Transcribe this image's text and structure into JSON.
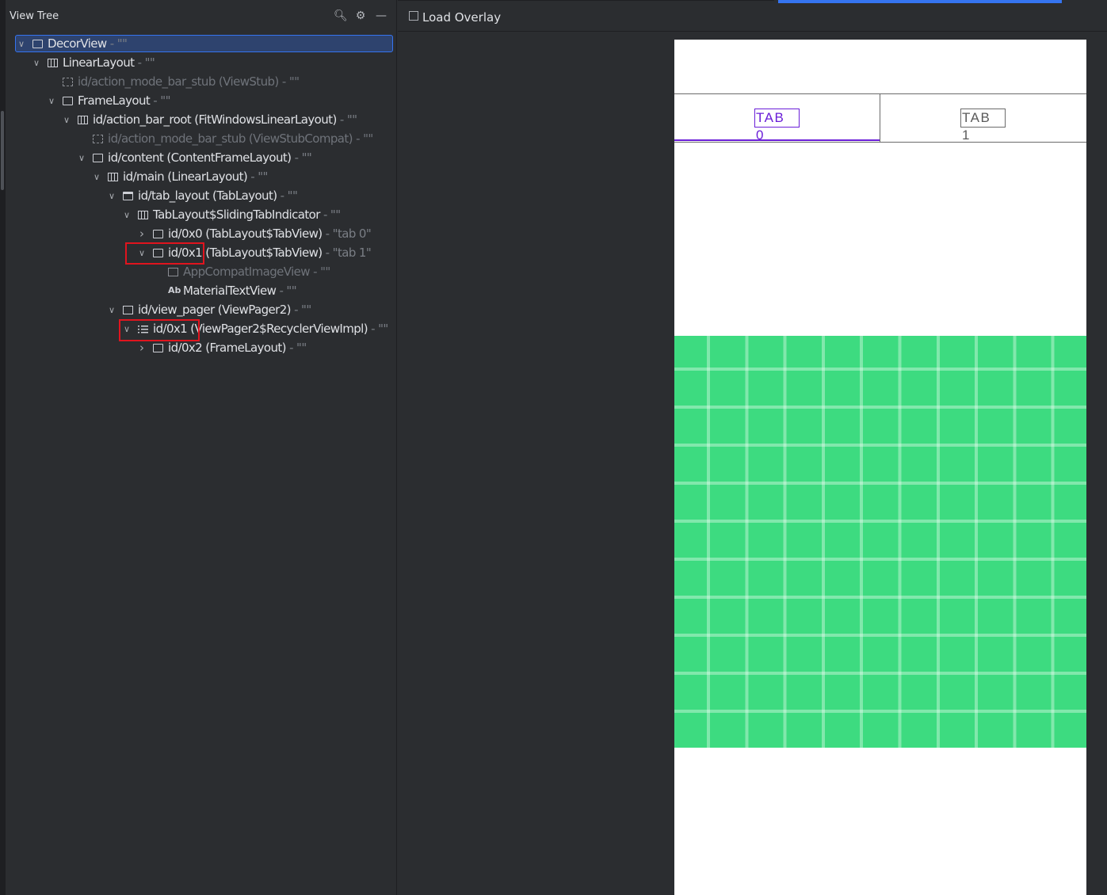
{
  "tree_panel": {
    "title": "View Tree",
    "icons": [
      "search-icon",
      "gear-icon",
      "minimize-icon"
    ]
  },
  "tree": [
    {
      "label": "DecorView",
      "suffix": " - \"\"",
      "depth": 0,
      "chevron": "down",
      "icon": "rect",
      "selected": true,
      "dim": false
    },
    {
      "label": "LinearLayout",
      "suffix": " - \"\"",
      "depth": 1,
      "chevron": "down",
      "icon": "linear",
      "dim": false
    },
    {
      "label": "id/action_mode_bar_stub (ViewStub)",
      "suffix": " - \"\"",
      "depth": 2,
      "chevron": "",
      "icon": "dash",
      "dim": true
    },
    {
      "label": "FrameLayout",
      "suffix": " - \"\"",
      "depth": 2,
      "chevron": "down",
      "icon": "rect",
      "dim": false
    },
    {
      "label": "id/action_bar_root (FitWindowsLinearLayout)",
      "suffix": " - \"\"",
      "depth": 3,
      "chevron": "down",
      "icon": "linear",
      "dim": false
    },
    {
      "label": "id/action_mode_bar_stub (ViewStubCompat)",
      "suffix": " - \"\"",
      "depth": 4,
      "chevron": "",
      "icon": "dash",
      "dim": true
    },
    {
      "label": "id/content (ContentFrameLayout)",
      "suffix": " - \"\"",
      "depth": 4,
      "chevron": "down",
      "icon": "rect",
      "dim": false
    },
    {
      "label": "id/main (LinearLayout)",
      "suffix": " - \"\"",
      "depth": 5,
      "chevron": "down",
      "icon": "linear",
      "dim": false
    },
    {
      "label": "id/tab_layout (TabLayout)",
      "suffix": " - \"\"",
      "depth": 6,
      "chevron": "down",
      "icon": "folder",
      "dim": false
    },
    {
      "label": "TabLayout$SlidingTabIndicator",
      "suffix": " - \"\"",
      "depth": 7,
      "chevron": "down",
      "icon": "linear",
      "dim": false
    },
    {
      "label": "id/0x0 (TabLayout$TabView)",
      "suffix": " - \"tab 0\"",
      "depth": 8,
      "chevron": "right",
      "icon": "rect",
      "dim": false
    },
    {
      "label": "id/0x1 (TabLayout$TabView)",
      "suffix": " - \"tab 1\"",
      "depth": 8,
      "chevron": "down",
      "icon": "rect",
      "dim": false
    },
    {
      "label": "AppCompatImageView",
      "suffix": " - \"\"",
      "depth": 9,
      "chevron": "",
      "icon": "image",
      "dim": true
    },
    {
      "label": "MaterialTextView",
      "suffix": " - \"\"",
      "depth": 9,
      "chevron": "",
      "icon": "ab",
      "dim": false
    },
    {
      "label": "id/view_pager (ViewPager2)",
      "suffix": " - \"\"",
      "depth": 6,
      "chevron": "down",
      "icon": "pager",
      "dim": false
    },
    {
      "label": "id/0x1 (ViewPager2$RecyclerViewImpl)",
      "suffix": " - \"\"",
      "depth": 7,
      "chevron": "down",
      "icon": "list",
      "dim": false
    },
    {
      "label": "id/0x2 (FrameLayout)",
      "suffix": " - \"\"",
      "depth": 8,
      "chevron": "right",
      "icon": "rect",
      "dim": false
    }
  ],
  "right_panel": {
    "load_overlay_label": "Load Overlay"
  },
  "device": {
    "tabs": [
      {
        "label": "TAB 0",
        "selected": true
      },
      {
        "label": "TAB 1",
        "selected": false
      }
    ]
  },
  "colors": {
    "selection": "#2e436e",
    "accent": "#3574f0",
    "tab_selected": "#6a1ed8",
    "content_green": "#3ddb80",
    "highlight_red": "#e0141e"
  }
}
